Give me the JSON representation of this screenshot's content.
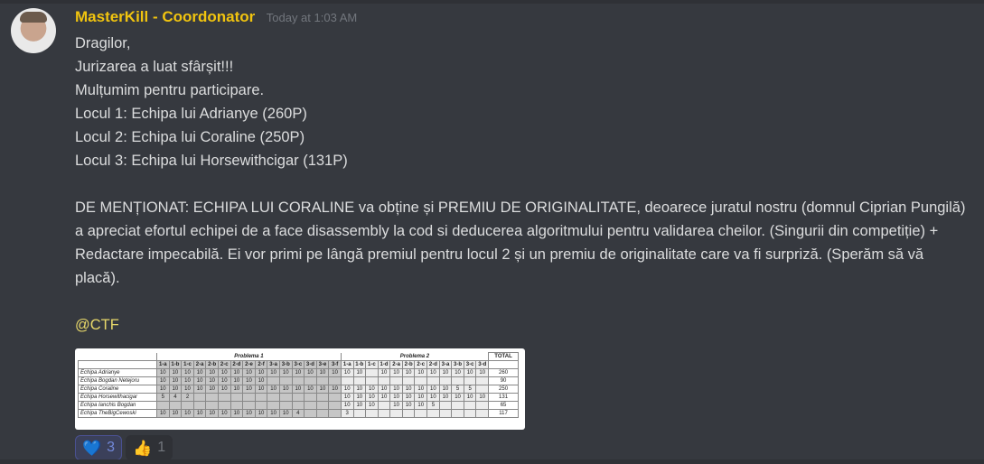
{
  "message": {
    "author": "MasterKill - Coordonator",
    "author_color": "#f1c40f",
    "timestamp": "Today at 1:03 AM",
    "lines": [
      "Dragilor,",
      "Jurizarea a luat sfârșit!!!",
      "Mulțumim pentru participare.",
      "Locul 1: Echipa lui Adrianye (260P)",
      "Locul 2: Echipa lui Coraline (250P)",
      "Locul 3: Echipa lui Horsewithcigar (131P)",
      "",
      "DE MENȚIONAT: ECHIPA LUI CORALINE va obține și PREMIU DE ORIGINALITATE, deoarece juratul nostru (domnul Ciprian Pungilă) a apreciat efortul echipei de a face disassembly la cod si deducerea algoritmului pentru validarea cheilor. (Singurii din competiție) + Redactare impecabilă. Ei vor primi pe lângă premiul pentru locul 2 și un premiu de originalitate care va fi surpriză. (Sperăm să vă placă).",
      ""
    ],
    "mention": "@CTF"
  },
  "attachment": {
    "group1": "Problema 1",
    "group2": "Problema 2",
    "total_header": "TOTAL",
    "p1_columns": [
      "1-a",
      "1-b",
      "1-c",
      "2-a",
      "2-b",
      "2-c",
      "2-d",
      "2-e",
      "2-f",
      "3-a",
      "3-b",
      "3-c",
      "3-d",
      "3-e",
      "3-f"
    ],
    "p2_columns": [
      "1-a",
      "1-b",
      "1-c",
      "1-d",
      "2-a",
      "2-b",
      "2-c",
      "2-d",
      "3-a",
      "3-b",
      "3-c",
      "3-d"
    ],
    "rows": [
      {
        "team": "Echipa Adrianye",
        "p1": [
          "10",
          "10",
          "10",
          "10",
          "10",
          "10",
          "10",
          "10",
          "10",
          "10",
          "10",
          "10",
          "10",
          "10",
          "10"
        ],
        "p2": [
          "10",
          "10",
          "",
          "10",
          "10",
          "10",
          "10",
          "10",
          "10",
          "10",
          "10",
          "10"
        ],
        "total": "260"
      },
      {
        "team": "Echipa Bogdan Netejoru",
        "p1": [
          "10",
          "10",
          "10",
          "10",
          "10",
          "10",
          "10",
          "10",
          "10",
          "",
          "",
          "",
          "",
          "",
          ""
        ],
        "p2": [
          "",
          "",
          "",
          "",
          "",
          "",
          "",
          "",
          "",
          "",
          "",
          ""
        ],
        "total": "90"
      },
      {
        "team": "Echipa Coraline",
        "p1": [
          "10",
          "10",
          "10",
          "10",
          "10",
          "10",
          "10",
          "10",
          "10",
          "10",
          "10",
          "10",
          "10",
          "10",
          "10"
        ],
        "p2": [
          "10",
          "10",
          "10",
          "10",
          "10",
          "10",
          "10",
          "10",
          "10",
          "5",
          "5",
          ""
        ],
        "total": "250"
      },
      {
        "team": "Echipa Horsewithacigar",
        "p1": [
          "5",
          "4",
          "2",
          "",
          "",
          "",
          "",
          "",
          "",
          "",
          "",
          "",
          "",
          "",
          ""
        ],
        "p2": [
          "10",
          "10",
          "10",
          "10",
          "10",
          "10",
          "10",
          "10",
          "10",
          "10",
          "10",
          "10"
        ],
        "total": "131"
      },
      {
        "team": "Echipa Ianchis Bogdan",
        "p1": [
          "",
          "",
          "",
          "",
          "",
          "",
          "",
          "",
          "",
          "",
          "",
          "",
          "",
          "",
          ""
        ],
        "p2": [
          "10",
          "10",
          "10",
          "",
          "10",
          "10",
          "10",
          "5",
          "",
          "",
          "",
          ""
        ],
        "total": "65"
      },
      {
        "team": "Echipa TheBigCewoski",
        "p1": [
          "10",
          "10",
          "10",
          "10",
          "10",
          "10",
          "10",
          "10",
          "10",
          "10",
          "10",
          "4",
          "",
          "",
          ""
        ],
        "p2": [
          "3",
          "",
          "",
          "",
          "",
          "",
          "",
          "",
          "",
          "",
          "",
          ""
        ],
        "total": "117"
      }
    ]
  },
  "reactions": [
    {
      "icon": "heart-icon",
      "emoji": "💙",
      "count": "3",
      "selected": true
    },
    {
      "icon": "thumbs-up-icon",
      "emoji": "👍",
      "count": "1",
      "selected": false
    }
  ]
}
